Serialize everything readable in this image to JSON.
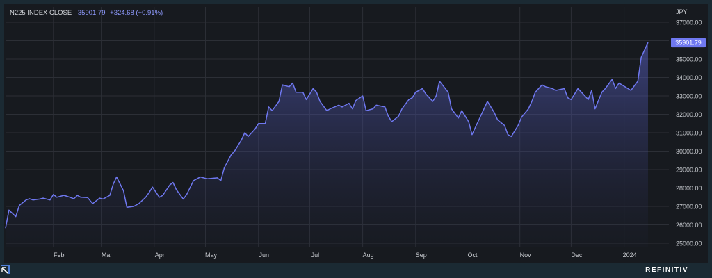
{
  "header": {
    "name": "N225 INDEX CLOSE",
    "value": "35901.79",
    "change": "+324.68 (+0.91%)"
  },
  "footer": {
    "brand": "REFINITIV",
    "brand_icon": "refinitiv-logo-icon"
  },
  "colors": {
    "background": "#171a1f",
    "frame": "#1b2a33",
    "line": "#6f78f0",
    "grid": "#2c2f36",
    "axis_text": "#c9ccd1",
    "last_value_tag": "#6f78f0"
  },
  "chart_data": {
    "type": "area",
    "title": "N225 INDEX CLOSE",
    "series": [
      {
        "name": "N225 INDEX CLOSE",
        "x": [
          "2023-01-04",
          "2023-01-06",
          "2023-01-10",
          "2023-01-12",
          "2023-01-16",
          "2023-01-18",
          "2023-01-20",
          "2023-01-24",
          "2023-01-26",
          "2023-01-30",
          "2023-02-01",
          "2023-02-03",
          "2023-02-07",
          "2023-02-09",
          "2023-02-13",
          "2023-02-15",
          "2023-02-17",
          "2023-02-21",
          "2023-02-24",
          "2023-02-28",
          "2023-03-02",
          "2023-03-06",
          "2023-03-08",
          "2023-03-10",
          "2023-03-14",
          "2023-03-16",
          "2023-03-20",
          "2023-03-23",
          "2023-03-27",
          "2023-03-29",
          "2023-03-31",
          "2023-04-04",
          "2023-04-06",
          "2023-04-10",
          "2023-04-12",
          "2023-04-14",
          "2023-04-18",
          "2023-04-20",
          "2023-04-24",
          "2023-04-26",
          "2023-04-28",
          "2023-05-02",
          "2023-05-08",
          "2023-05-10",
          "2023-05-12",
          "2023-05-16",
          "2023-05-18",
          "2023-05-22",
          "2023-05-24",
          "2023-05-26",
          "2023-05-30",
          "2023-06-01",
          "2023-06-05",
          "2023-06-07",
          "2023-06-09",
          "2023-06-13",
          "2023-06-15",
          "2023-06-19",
          "2023-06-21",
          "2023-06-23",
          "2023-06-27",
          "2023-06-29",
          "2023-07-03",
          "2023-07-05",
          "2023-07-07",
          "2023-07-11",
          "2023-07-13",
          "2023-07-18",
          "2023-07-20",
          "2023-07-24",
          "2023-07-26",
          "2023-07-28",
          "2023-08-01",
          "2023-08-03",
          "2023-08-07",
          "2023-08-09",
          "2023-08-14",
          "2023-08-16",
          "2023-08-18",
          "2023-08-22",
          "2023-08-24",
          "2023-08-28",
          "2023-08-30",
          "2023-09-01",
          "2023-09-05",
          "2023-09-07",
          "2023-09-11",
          "2023-09-13",
          "2023-09-15",
          "2023-09-20",
          "2023-09-22",
          "2023-09-26",
          "2023-09-28",
          "2023-10-02",
          "2023-10-04",
          "2023-10-06",
          "2023-10-11",
          "2023-10-13",
          "2023-10-17",
          "2023-10-19",
          "2023-10-23",
          "2023-10-25",
          "2023-10-27",
          "2023-10-31",
          "2023-11-02",
          "2023-11-06",
          "2023-11-08",
          "2023-11-10",
          "2023-11-14",
          "2023-11-16",
          "2023-11-20",
          "2023-11-22",
          "2023-11-27",
          "2023-11-29",
          "2023-12-01",
          "2023-12-05",
          "2023-12-07",
          "2023-12-11",
          "2023-12-13",
          "2023-12-15",
          "2023-12-19",
          "2023-12-21",
          "2023-12-25",
          "2023-12-27",
          "2023-12-29",
          "2024-01-05",
          "2024-01-09",
          "2024-01-11",
          "2024-01-15"
        ],
        "values": [
          25820,
          26800,
          26450,
          27050,
          27350,
          27420,
          27350,
          27400,
          27450,
          27350,
          27650,
          27500,
          27600,
          27550,
          27420,
          27600,
          27500,
          27480,
          27150,
          27450,
          27400,
          27600,
          28200,
          28600,
          27850,
          26950,
          27000,
          27150,
          27500,
          27750,
          28050,
          27500,
          27600,
          28150,
          28300,
          27900,
          27400,
          27650,
          28400,
          28500,
          28600,
          28500,
          28550,
          28400,
          29100,
          29800,
          30000,
          30600,
          31000,
          30800,
          31200,
          31500,
          31500,
          32400,
          32200,
          32700,
          33600,
          33500,
          33700,
          33200,
          33200,
          32800,
          33400,
          33200,
          32700,
          32200,
          32300,
          32500,
          32400,
          32600,
          32300,
          32750,
          33000,
          32200,
          32300,
          32500,
          32400,
          31900,
          31600,
          31900,
          32300,
          32800,
          32900,
          33200,
          33400,
          33100,
          32700,
          33000,
          33800,
          33200,
          32300,
          31800,
          32200,
          31600,
          30900,
          31300,
          32300,
          32700,
          32100,
          31700,
          31400,
          30900,
          30800,
          31400,
          31850,
          32300,
          32700,
          33200,
          33600,
          33500,
          33400,
          33300,
          33400,
          32900,
          32800,
          33400,
          33200,
          32800,
          33300,
          32300,
          33200,
          33400,
          33900,
          33400,
          33700,
          33300,
          33800,
          35100,
          35901.79
        ]
      }
    ],
    "last_value_label": "35901.79",
    "xlabel": "",
    "ylabel": "JPY",
    "ylim": [
      25000,
      37000
    ],
    "y_ticks": [
      "25000.00",
      "26000.00",
      "27000.00",
      "28000.00",
      "29000.00",
      "30000.00",
      "31000.00",
      "32000.00",
      "33000.00",
      "34000.00",
      "35000.00",
      "36000.00",
      "37000.00"
    ],
    "x_ticks": [
      {
        "label": "Feb",
        "date": "2023-02-01"
      },
      {
        "label": "Mar",
        "date": "2023-03-01"
      },
      {
        "label": "Apr",
        "date": "2023-04-01"
      },
      {
        "label": "May",
        "date": "2023-05-01"
      },
      {
        "label": "Jun",
        "date": "2023-06-01"
      },
      {
        "label": "Jul",
        "date": "2023-07-01"
      },
      {
        "label": "Aug",
        "date": "2023-08-01"
      },
      {
        "label": "Sep",
        "date": "2023-09-01"
      },
      {
        "label": "Oct",
        "date": "2023-10-01"
      },
      {
        "label": "Nov",
        "date": "2023-11-01"
      },
      {
        "label": "Dec",
        "date": "2023-12-01"
      },
      {
        "label": "2024",
        "date": "2024-01-01"
      }
    ],
    "grid": true,
    "legend": "none"
  }
}
